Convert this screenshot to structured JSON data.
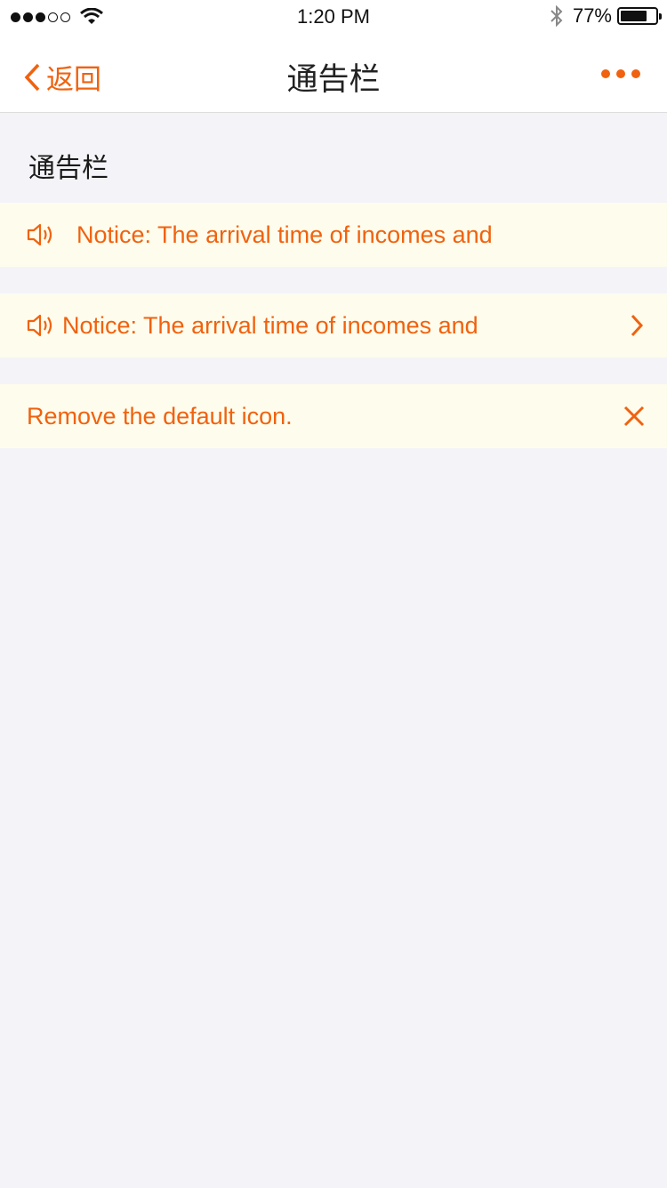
{
  "status_bar": {
    "time": "1:20 PM",
    "battery_text": "77%",
    "battery_level": 0.77,
    "signal_bars_filled": 3,
    "signal_bars_total": 5
  },
  "nav": {
    "back_label": "返回",
    "title": "通告栏"
  },
  "section_title": "通告栏",
  "noticebars": [
    {
      "text": "Notice: The arrival time of incomes and",
      "icon": "speaker-icon",
      "action": "none"
    },
    {
      "text": "Notice: The arrival time of incomes and",
      "icon": "speaker-icon",
      "action": "chevron-right-icon"
    },
    {
      "text": "Remove the default icon.",
      "icon": "none",
      "action": "close-icon"
    }
  ],
  "colors": {
    "accent": "#f0620f",
    "notice_bg": "#fefcec",
    "page_bg": "#f4f4f8"
  }
}
